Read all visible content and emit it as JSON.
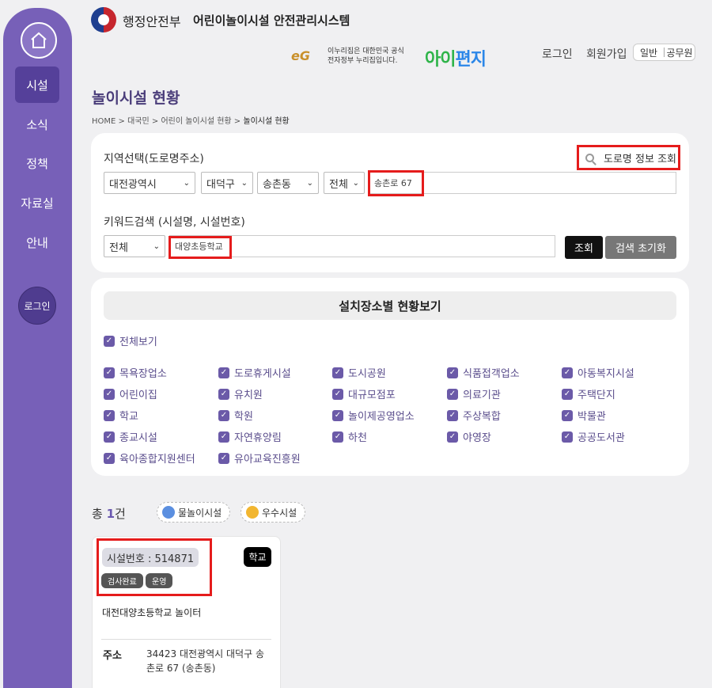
{
  "header": {
    "ministry": "행정안전부",
    "system_name": "어린이놀이시설 안전관리시스템",
    "eg_logo": "eG",
    "eg_line1": "이누리집은 대한민국 공식",
    "eg_line2": "전자정부 누리집입니다.",
    "brand_a": "아이",
    "brand_b": "편지",
    "login": "로그인",
    "signup": "회원가입",
    "role_general": "일반",
    "role_official": "공무원"
  },
  "sidebar": {
    "home_icon": "home-icon",
    "items": [
      {
        "label": "시설",
        "active": true
      },
      {
        "label": "소식"
      },
      {
        "label": "정책"
      },
      {
        "label": "자료실"
      },
      {
        "label": "안내"
      }
    ],
    "login": "로그인"
  },
  "page": {
    "title": "놀이시설 현황",
    "breadcrumb": [
      "HOME",
      "대국민",
      "어린이 놀이시설 현황",
      "놀이시설 현황"
    ]
  },
  "search": {
    "region_label": "지역선택(도로명주소)",
    "road_lookup": "도로명 정보 조회",
    "city": "대전광역시",
    "district": "대덕구",
    "dong": "송촌동",
    "scope": "전체",
    "road_value": "송촌로 67",
    "keyword_label": "키워드검색 (시설명, 시설번호)",
    "keyword_type": "전체",
    "keyword_value": "대양초등학교",
    "search_btn": "조회",
    "reset_btn": "검색 초기화"
  },
  "categories": {
    "title": "설치장소별 현황보기",
    "all": "전체보기",
    "items": [
      "목욕장업소",
      "도로휴게시설",
      "도시공원",
      "식품접객업소",
      "아동복지시설",
      "어린이집",
      "유치원",
      "대규모점포",
      "의료기관",
      "주택단지",
      "학교",
      "학원",
      "놀이제공영업소",
      "주상복합",
      "박물관",
      "종교시설",
      "자연휴양림",
      "하천",
      "야영장",
      "공공도서관",
      "육아종합지원센터",
      "유아교육진흥원"
    ]
  },
  "results": {
    "total_prefix": "총",
    "total_count": "1",
    "total_suffix": "건",
    "chip_water": "물놀이시설",
    "chip_excellent": "우수시설",
    "card": {
      "facility_no": "시설번호 : 514871",
      "status_inspected": "검사완료",
      "status_operating": "운영",
      "type": "학교",
      "name": "대전대양초등학교 놀이터",
      "addr_label": "주소",
      "address": "34423 대전광역시 대덕구 송촌로 67 (송촌동)"
    }
  },
  "colors": {
    "sidebar": "#7760b8",
    "accent": "#6b5aa8",
    "highlight": "#e51c1c"
  }
}
